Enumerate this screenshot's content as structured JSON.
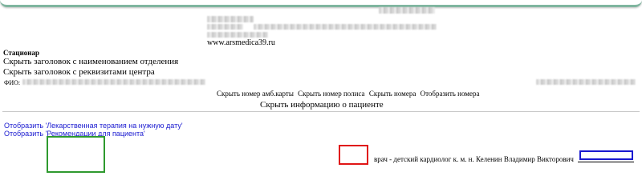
{
  "header": {
    "website": "www.arsmedica39.ru"
  },
  "department": {
    "label": "Стационар",
    "hide_department_header": "Скрыть заголовок с наименованием отделения",
    "hide_center_requisites": "Скрыть заголовок с реквизитами центра"
  },
  "patient": {
    "fio_label": "ФИО:",
    "links": [
      "Скрыть номер амб.карты",
      "Скрыть номер полиса",
      "Скрыть номера",
      "Отобразить номера"
    ],
    "hide_info": "Скрыть информацию о пациенте"
  },
  "actions": {
    "show_drug_therapy": "Отобразить 'Лекарственная терапия на нужную дату'",
    "show_recommendations": "Отобразить 'Рекомендации для пациента'"
  },
  "signature": {
    "doctor": "врач - детский кардиолог к. м. н. Келенин Владимир Викторович"
  },
  "colors": {
    "accent_bar": "#7fb59f",
    "link": "#1a1ad0",
    "stamp_box": "#2e9a2e",
    "red_box": "#e01515",
    "signature_box": "#1a1ad0"
  }
}
